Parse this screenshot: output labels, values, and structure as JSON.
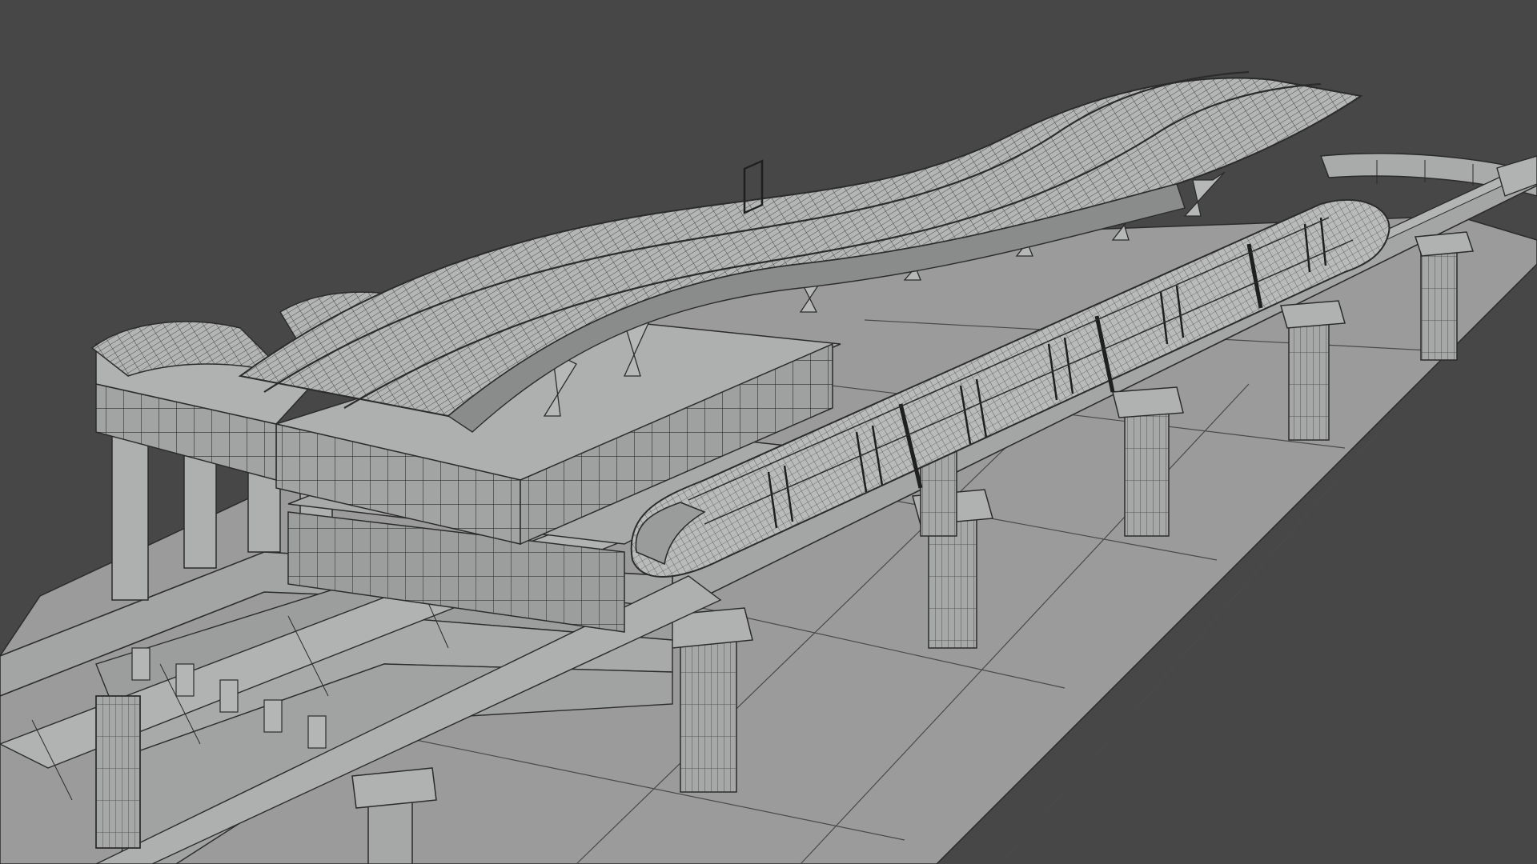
{
  "viewport": {
    "background": "#474747",
    "render_mode": "wireframe-shaded",
    "subject": "elevated-monorail-station"
  },
  "palette": {
    "ground": "#9a9b9a",
    "concrete": "#a6a8a7",
    "concrete_dark": "#8e908f",
    "roof": "#b4b6b5",
    "roof_shadow": "#8a8c8b",
    "train": "#b9bbba",
    "wire": "#2b2b2b",
    "glass": "#a9abaa"
  },
  "scene_objects": {
    "train_car_count": 4,
    "track_pier_count_visible": 8,
    "roof_wave_count": 2
  }
}
